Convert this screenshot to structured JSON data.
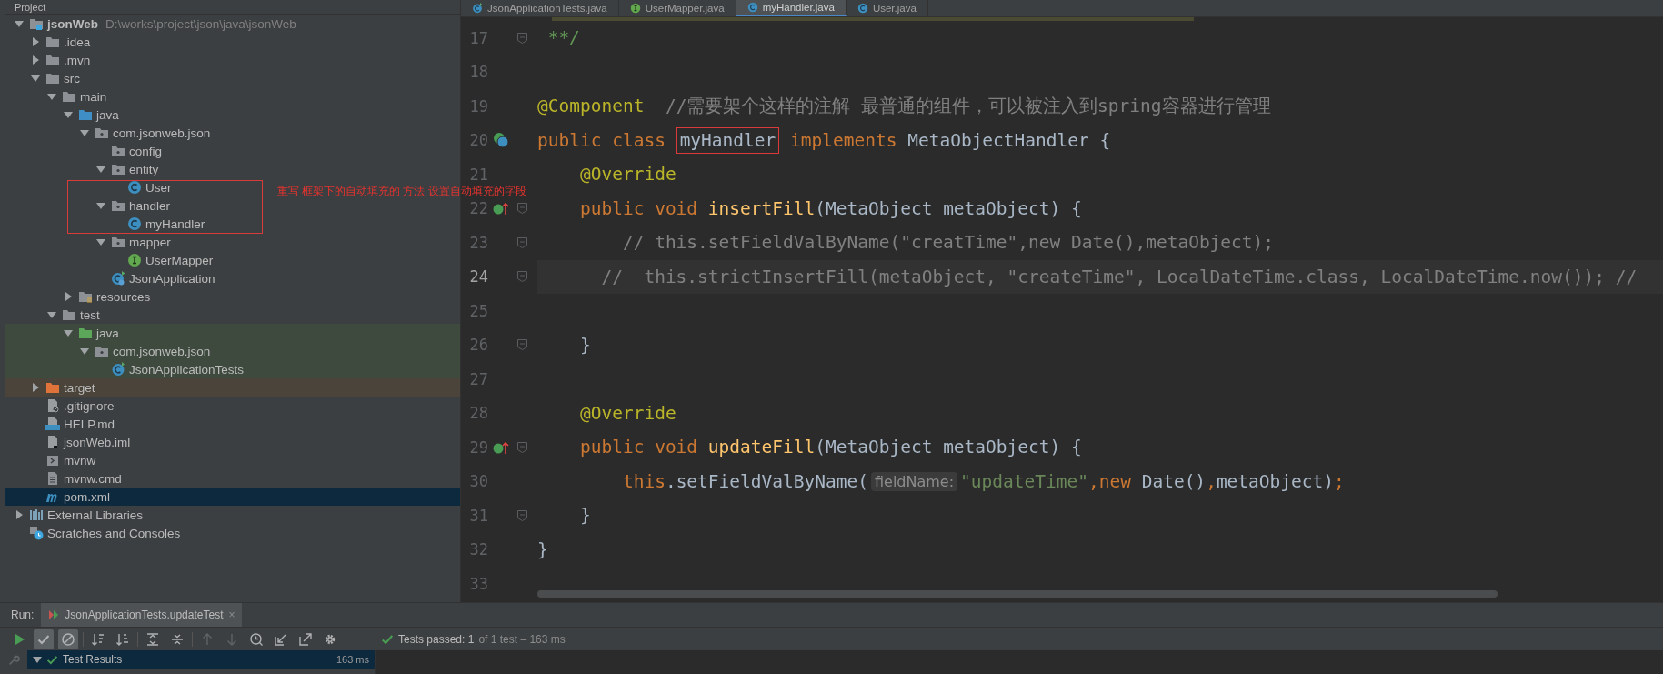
{
  "project_panel": {
    "title": "Project",
    "tree": [
      {
        "label": "jsonWeb",
        "path": "D:\\works\\project\\json\\java\\jsonWeb",
        "kind": "module",
        "expanded": true,
        "selected": false,
        "children": [
          {
            "label": ".idea",
            "kind": "folder",
            "expanded": false,
            "selected": false
          },
          {
            "label": ".mvn",
            "kind": "folder",
            "expanded": false,
            "selected": false
          },
          {
            "label": "src",
            "kind": "folder",
            "expanded": true,
            "selected": false,
            "children": [
              {
                "label": "main",
                "kind": "folder",
                "expanded": true,
                "selected": false,
                "children": [
                  {
                    "label": "java",
                    "kind": "source-folder",
                    "expanded": true,
                    "selected": false,
                    "children": [
                      {
                        "label": "com.jsonweb.json",
                        "kind": "package",
                        "expanded": true,
                        "selected": false,
                        "children": [
                          {
                            "label": "config",
                            "kind": "package",
                            "selected": false
                          },
                          {
                            "label": "entity",
                            "kind": "package",
                            "expanded": true,
                            "selected": false,
                            "children": [
                              {
                                "label": "User",
                                "kind": "class",
                                "selected": false
                              }
                            ]
                          },
                          {
                            "label": "handler",
                            "kind": "package",
                            "expanded": true,
                            "selected": false,
                            "children": [
                              {
                                "label": "myHandler",
                                "kind": "class",
                                "selected": false
                              }
                            ]
                          },
                          {
                            "label": "mapper",
                            "kind": "package",
                            "expanded": true,
                            "selected": false,
                            "children": [
                              {
                                "label": "UserMapper",
                                "kind": "interface",
                                "selected": false
                              }
                            ]
                          },
                          {
                            "label": "JsonApplication",
                            "kind": "app-class",
                            "selected": false
                          }
                        ]
                      }
                    ]
                  },
                  {
                    "label": "resources",
                    "kind": "resources",
                    "expanded": false,
                    "selected": false
                  }
                ]
              },
              {
                "label": "test",
                "kind": "folder",
                "expanded": true,
                "selected": false,
                "children": [
                  {
                    "label": "java",
                    "kind": "test-folder",
                    "test_source": true,
                    "expanded": true,
                    "selected": false,
                    "children": [
                      {
                        "label": "com.jsonweb.json",
                        "kind": "package",
                        "expanded": true,
                        "selected": false,
                        "children": [
                          {
                            "label": "JsonApplicationTests",
                            "kind": "test-class",
                            "selected": false
                          }
                        ]
                      }
                    ]
                  }
                ]
              }
            ]
          },
          {
            "label": "target",
            "kind": "excluded-folder",
            "excluded": true,
            "expanded": false,
            "selected": false
          },
          {
            "label": ".gitignore",
            "kind": "gitignore",
            "selected": false
          },
          {
            "label": "HELP.md",
            "kind": "markdown",
            "selected": false
          },
          {
            "label": "jsonWeb.iml",
            "kind": "iml",
            "selected": false
          },
          {
            "label": "mvnw",
            "kind": "script",
            "selected": false
          },
          {
            "label": "mvnw.cmd",
            "kind": "text-file",
            "selected": false
          },
          {
            "label": "pom.xml",
            "kind": "maven",
            "selected": true
          }
        ]
      },
      {
        "label": "External Libraries",
        "kind": "libraries",
        "expanded": false,
        "selected": false
      },
      {
        "label": "Scratches and Consoles",
        "kind": "scratches",
        "selected": false
      }
    ]
  },
  "editor": {
    "tabs": [
      {
        "label": "JsonApplicationTests.java",
        "kind": "test-class",
        "selected": false
      },
      {
        "label": "UserMapper.java",
        "kind": "interface",
        "selected": false
      },
      {
        "label": "myHandler.java",
        "kind": "class",
        "selected": true
      },
      {
        "label": "User.java",
        "kind": "class",
        "selected": false
      }
    ],
    "lines": [
      {
        "number": "17",
        "fold": true,
        "current": false,
        "segments": [
          {
            "kind": "doc",
            "text": " **/"
          }
        ]
      },
      {
        "number": "18",
        "fold": false,
        "current": false
      },
      {
        "number": "19",
        "fold": false,
        "current": false,
        "segments": [
          {
            "kind": "annotation",
            "text": "@Component"
          },
          {
            "kind": "comment",
            "text": "  //需要架个这样的注解 最普通的组件，可以被注入到spring容器进行管理"
          }
        ]
      },
      {
        "number": "20",
        "fold": false,
        "current": false,
        "implemented": true,
        "segments": [
          {
            "kind": "keyword",
            "text": "public class "
          },
          {
            "kind": "plain",
            "text": "myHandler",
            "framed": true
          },
          {
            "kind": "keyword",
            "text": " implements "
          },
          {
            "kind": "plain",
            "text": "MetaObjectHandler {"
          }
        ]
      },
      {
        "number": "21",
        "fold": false,
        "current": false,
        "segments": [
          {
            "kind": "annotation",
            "text": "    @Override"
          }
        ]
      },
      {
        "number": "22",
        "fold": true,
        "current": false,
        "overrides": true,
        "segments": [
          {
            "kind": "keyword",
            "text": "    public void "
          },
          {
            "kind": "decl",
            "text": "insertFill"
          },
          {
            "kind": "plain",
            "text": "(MetaObject metaObject) {"
          }
        ]
      },
      {
        "number": "23",
        "fold": true,
        "current": false,
        "segments": [
          {
            "kind": "comment",
            "text": "        // this.setFieldValByName(\"creatTime\",new Date(),metaObject);"
          }
        ]
      },
      {
        "number": "24",
        "fold": true,
        "current": true,
        "segments": [
          {
            "kind": "comment",
            "text": "      //  this.strictInsertFill(metaObject, \"createTime\", LocalDateTime.class, LocalDateTime.now()); //"
          }
        ]
      },
      {
        "number": "25",
        "fold": false,
        "current": false
      },
      {
        "number": "26",
        "fold": true,
        "current": false,
        "segments": [
          {
            "kind": "plain",
            "text": "    }"
          }
        ]
      },
      {
        "number": "27",
        "fold": false,
        "current": false
      },
      {
        "number": "28",
        "fold": false,
        "current": false,
        "segments": [
          {
            "kind": "annotation",
            "text": "    @Override"
          }
        ]
      },
      {
        "number": "29",
        "fold": true,
        "current": false,
        "overrides": true,
        "segments": [
          {
            "kind": "keyword",
            "text": "    public void "
          },
          {
            "kind": "decl",
            "text": "updateFill"
          },
          {
            "kind": "plain",
            "text": "(MetaObject metaObject) {"
          }
        ]
      },
      {
        "number": "30",
        "fold": false,
        "current": false,
        "segments": [
          {
            "kind": "keyword",
            "text": "        this"
          },
          {
            "kind": "plain",
            "text": ".setFieldValByName("
          },
          {
            "kind": "hint",
            "text": "fieldName:"
          },
          {
            "kind": "string",
            "text": "\"updateTime\""
          },
          {
            "kind": "keyword",
            "text": ",new "
          },
          {
            "kind": "plain",
            "text": "Date()"
          },
          {
            "kind": "keyword",
            "text": ","
          },
          {
            "kind": "plain",
            "text": "metaObject)"
          },
          {
            "kind": "keyword",
            "text": ";"
          }
        ]
      },
      {
        "number": "31",
        "fold": true,
        "current": false,
        "segments": [
          {
            "kind": "plain",
            "text": "    }"
          }
        ]
      },
      {
        "number": "32",
        "fold": false,
        "current": false,
        "segments": [
          {
            "kind": "plain",
            "text": "}"
          }
        ]
      },
      {
        "number": "33",
        "fold": false,
        "current": false
      }
    ]
  },
  "annotation": {
    "text": "重写 框架下的自动填充的 方法 设置自动填充的字段"
  },
  "run_panel": {
    "label": "Run:",
    "tabs": [
      {
        "label": "JsonApplicationTests.updateTest",
        "close": "×",
        "selected": true
      }
    ],
    "toolbar": [
      {
        "kind": "run",
        "pressed": false,
        "disabled": false
      },
      {
        "kind": "show-passed",
        "pressed": true,
        "disabled": false
      },
      {
        "kind": "show-ignored",
        "pressed": true,
        "disabled": false
      },
      {
        "kind": "sort-alpha",
        "pressed": false,
        "disabled": false
      },
      {
        "kind": "sort-duration",
        "pressed": false,
        "disabled": false
      },
      {
        "kind": "expand-all",
        "pressed": false,
        "disabled": false
      },
      {
        "kind": "collapse-all",
        "pressed": false,
        "disabled": false
      },
      {
        "kind": "previous",
        "pressed": false,
        "disabled": true
      },
      {
        "kind": "next",
        "pressed": false,
        "disabled": true
      },
      {
        "kind": "history",
        "pressed": false,
        "disabled": false
      },
      {
        "kind": "import",
        "pressed": false,
        "disabled": false
      },
      {
        "kind": "export",
        "pressed": false,
        "disabled": false
      },
      {
        "kind": "settings",
        "pressed": false,
        "disabled": false
      }
    ],
    "status": "Tests passed: 1",
    "status_detail": "of 1 test – 163 ms",
    "status_passed": true,
    "results": [
      {
        "label": "Test Results",
        "time": "163 ms",
        "expanded": true,
        "selected": true,
        "passed": true
      }
    ]
  }
}
